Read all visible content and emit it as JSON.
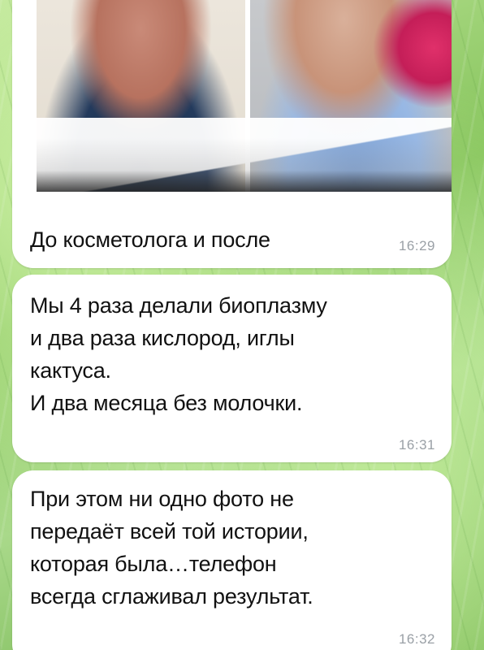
{
  "chat": {
    "messages": [
      {
        "type": "photo",
        "caption": "До косметолога и после",
        "time": "16:29"
      },
      {
        "type": "text",
        "lines": [
          "Мы 4 раза делали биоплазму",
          "и два раза кислород, иглы",
          "кактуса.",
          "И два месяца без молочки."
        ],
        "time": "16:31"
      },
      {
        "type": "text",
        "lines": [
          "При этом ни одно фото не",
          "передаёт всей той истории,",
          "которая была…телефон",
          "всегда сглаживал результат."
        ],
        "time": "16:32"
      }
    ]
  },
  "colors": {
    "bubble": "#ffffff",
    "text": "#111111",
    "timestamp": "#9aa0a6",
    "background_green": "#86c45c"
  }
}
